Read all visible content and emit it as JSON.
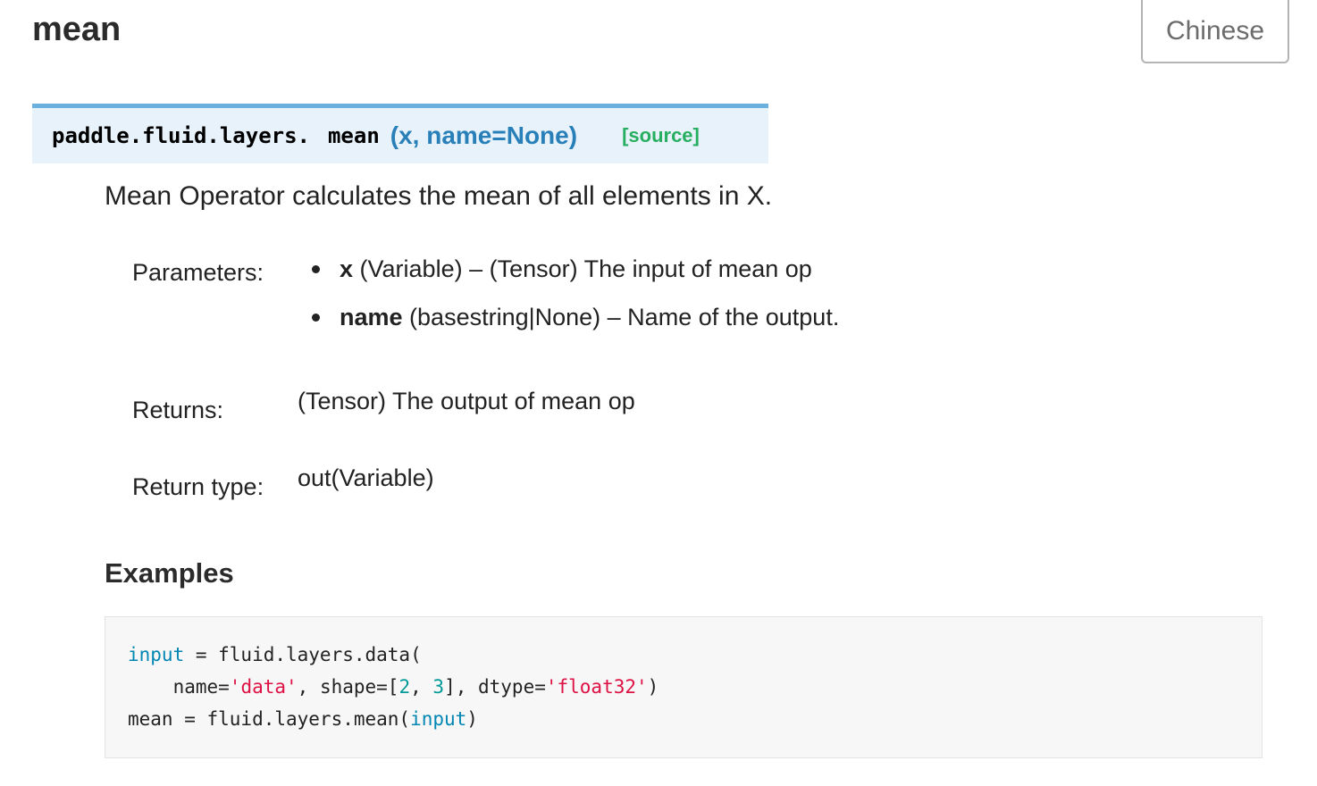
{
  "page": {
    "title": "mean",
    "language_button": "Chinese"
  },
  "signature": {
    "prefix": "paddle.fluid.layers.",
    "name": "mean",
    "params": "(x, name=None)",
    "source_link": "[source]"
  },
  "description": "Mean Operator calculates the mean of all elements in X.",
  "fields": {
    "parameters_label": "Parameters:",
    "parameters": [
      {
        "name": "x",
        "desc": " (Variable) – (Tensor) The input of mean op"
      },
      {
        "name": "name",
        "desc": " (basestring|None) – Name of the output."
      }
    ],
    "returns_label": "Returns:",
    "returns_value": "(Tensor) The output of mean op",
    "return_type_label": "Return type:",
    "return_type_value": "out(Variable)"
  },
  "examples": {
    "heading": "Examples",
    "code": {
      "line1": {
        "kw": "input",
        "rest": " = fluid.layers.data("
      },
      "line2": {
        "a": "    name=",
        "s1": "'data'",
        "b": ", shape=[",
        "n1": "2",
        "c": ", ",
        "n2": "3",
        "d": "], dtype=",
        "s2": "'float32'",
        "e": ")"
      },
      "line3": {
        "a": "mean = fluid.layers.mean(",
        "kw": "input",
        "b": ")"
      }
    }
  }
}
